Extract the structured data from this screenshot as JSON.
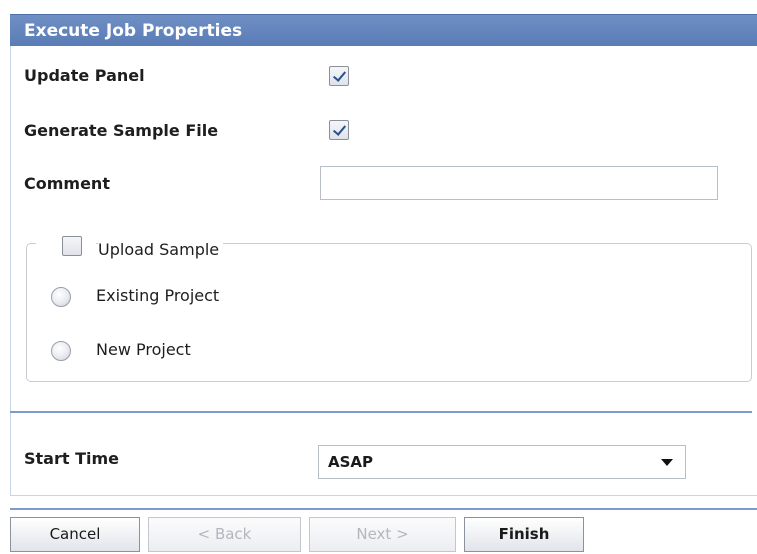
{
  "dialog": {
    "title": "Execute Job Properties"
  },
  "fields": {
    "update_panel": {
      "label": "Update Panel",
      "checked": true
    },
    "generate_sample_file": {
      "label": "Generate Sample File",
      "checked": true
    },
    "comment": {
      "label": "Comment",
      "value": "",
      "placeholder": ""
    }
  },
  "upload_sample": {
    "label": "Upload Sample",
    "checked": false,
    "options": [
      {
        "label": "Existing Project",
        "selected": false
      },
      {
        "label": "New Project",
        "selected": false
      }
    ]
  },
  "start_time": {
    "label": "Start Time",
    "selected": "ASAP"
  },
  "buttons": {
    "cancel": "Cancel",
    "back": "< Back",
    "next": "Next >",
    "finish": "Finish"
  },
  "colors": {
    "header_bg": "#5a7cb6",
    "divider": "#7d9bcb"
  },
  "icons": {
    "select_arrow": "chevron-down-icon"
  }
}
